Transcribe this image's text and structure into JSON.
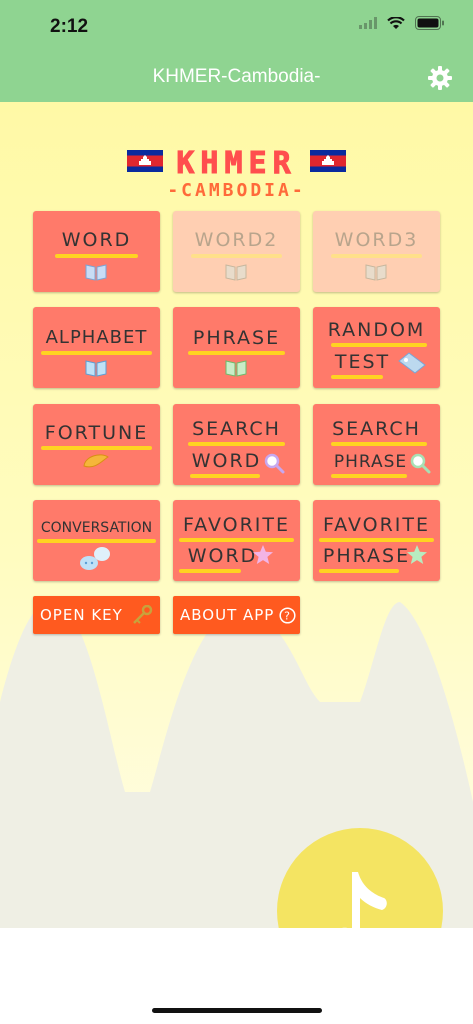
{
  "status": {
    "time": "2:12"
  },
  "nav": {
    "title": "KHMER-Cambodia-",
    "settings_icon": "gear-icon"
  },
  "logo": {
    "main": "KHMER",
    "sub": "-CAMBODIA-"
  },
  "menu": {
    "word": "WORD",
    "word2": "WORD2",
    "word3": "WORD3",
    "alphabet": "ALPHABET",
    "phrase": "PHRASE",
    "random_1": "RANDOM",
    "random_2": "TEST",
    "fortune": "FORTUNE",
    "search_word_1": "SEARCH",
    "search_word_2": "WORD",
    "search_phrase_1": "SEARCH",
    "search_phrase_2": "PHRASE",
    "conversation": "CONVERSATION",
    "favorite_word_1": "FAVORITE",
    "favorite_word_2": "WORD",
    "favorite_phrase_1": "FAVORITE",
    "favorite_phrase_2": "PHRASE"
  },
  "actions": {
    "open_key": "OPEN KEY",
    "about_app": "ABOUT APP"
  },
  "colors": {
    "nav": "#8fd491",
    "tile": "#ff7a6a",
    "tile_faded": "#ffcfb2",
    "accent_button": "#ff5a1f",
    "underline": "#ffd321",
    "music": "#f4e462"
  }
}
